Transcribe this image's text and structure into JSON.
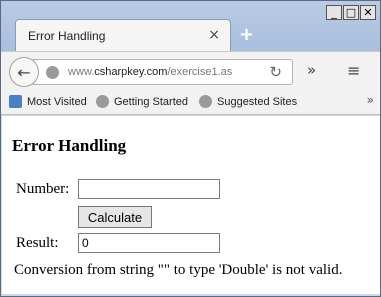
{
  "window": {
    "controls": {
      "minimize": "_",
      "maximize": "□",
      "close": "✕"
    }
  },
  "tab": {
    "title": "Error Handling",
    "close": "×",
    "new_tab": "+"
  },
  "navbar": {
    "back": "←",
    "url_prefix": "www.",
    "url_domain": "csharpkey.com",
    "url_path": "/exercise1.as",
    "reload": "↻",
    "more": "»",
    "menu": "≡"
  },
  "bookmarks": {
    "items": [
      {
        "label": "Most Visited",
        "icon": "bookmark-star-icon"
      },
      {
        "label": "Getting Started",
        "icon": "globe-icon"
      },
      {
        "label": "Suggested Sites",
        "icon": "globe-icon"
      }
    ],
    "overflow": "»"
  },
  "page": {
    "title": "Error Handling",
    "number_label": "Number:",
    "number_value": "",
    "calculate_label": "Calculate",
    "result_label": "Result:",
    "result_value": "0",
    "error_message": "Conversion from string \"\" to type 'Double' is not valid."
  }
}
